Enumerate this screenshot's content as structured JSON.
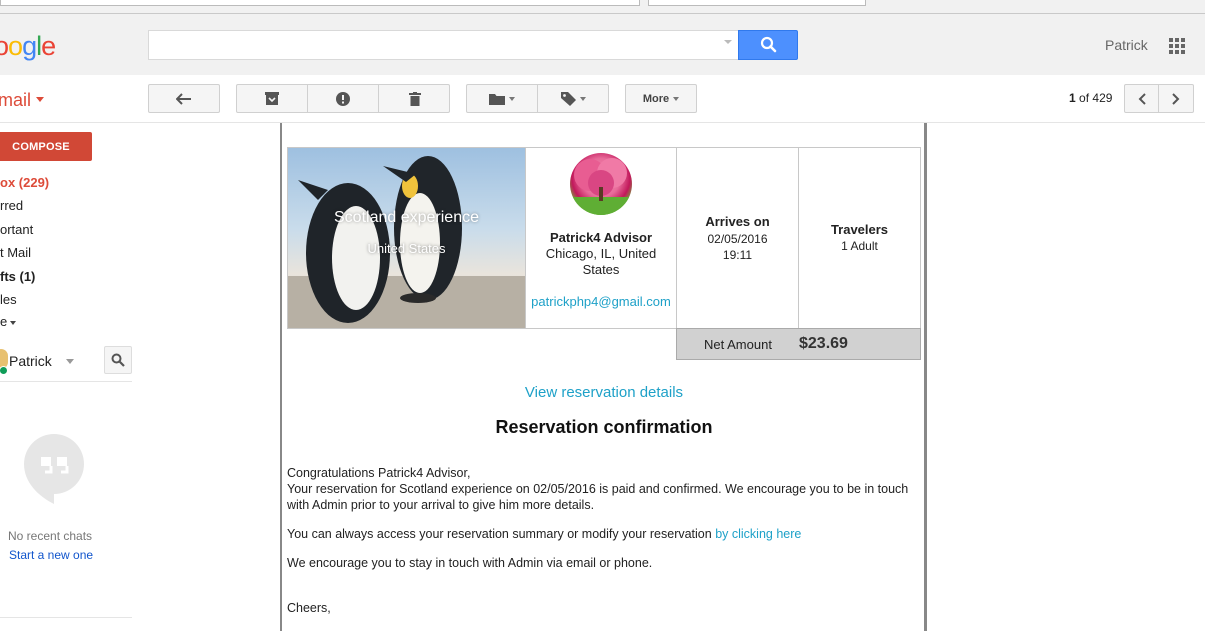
{
  "header": {
    "logo_text": "oogle",
    "logo_colors": [
      "#4285f4",
      "#ea4335",
      "#fbbc05",
      "#4285f4",
      "#34a853",
      "#ea4335"
    ],
    "search_placeholder": "",
    "user_name": "Patrick",
    "search_button_color": "#4d90fe"
  },
  "toolbar": {
    "app_label": "mail",
    "more_label": "More",
    "pager_current": "1",
    "pager_sep": "of",
    "pager_total": "429"
  },
  "sidebar": {
    "compose_label": "COMPOSE",
    "compose_color": "#d14836",
    "items": [
      {
        "label": "ox (229)"
      },
      {
        "label": "rred"
      },
      {
        "label": "ortant"
      },
      {
        "label": "t Mail"
      },
      {
        "label": "fts (1)"
      },
      {
        "label": "les"
      },
      {
        "label": "e"
      }
    ],
    "chat_user": "Patrick",
    "no_chats": "No recent chats",
    "start_new": "Start a new one"
  },
  "email": {
    "hero_title": "Scotland experience",
    "hero_location": "United States",
    "advisor_name": "Patrick4 Advisor",
    "advisor_location": "Chicago, IL, United States",
    "advisor_email": "patrickphp4@gmail.com",
    "arrives_label": "Arrives on",
    "arrives_date": "02/05/2016",
    "arrives_time": "19:11",
    "travelers_label": "Travelers",
    "travelers_value": "1 Adult",
    "net_label": "Net Amount",
    "net_value": "$23.69",
    "view_link": "View reservation details",
    "title": "Reservation confirmation",
    "greeting": "Congratulations Patrick4 Advisor,",
    "para1": "Your reservation for Scotland experience on 02/05/2016 is paid and confirmed. We encourage you to be in touch with Admin prior to your arrival to give him more details.",
    "para2_text": "You can always access your reservation summary or modify your reservation ",
    "para2_link": "by clicking here",
    "para3": "We encourage you to stay in touch with Admin via email or phone.",
    "signoff": "Cheers,",
    "link_color": "#1ea1c8"
  }
}
